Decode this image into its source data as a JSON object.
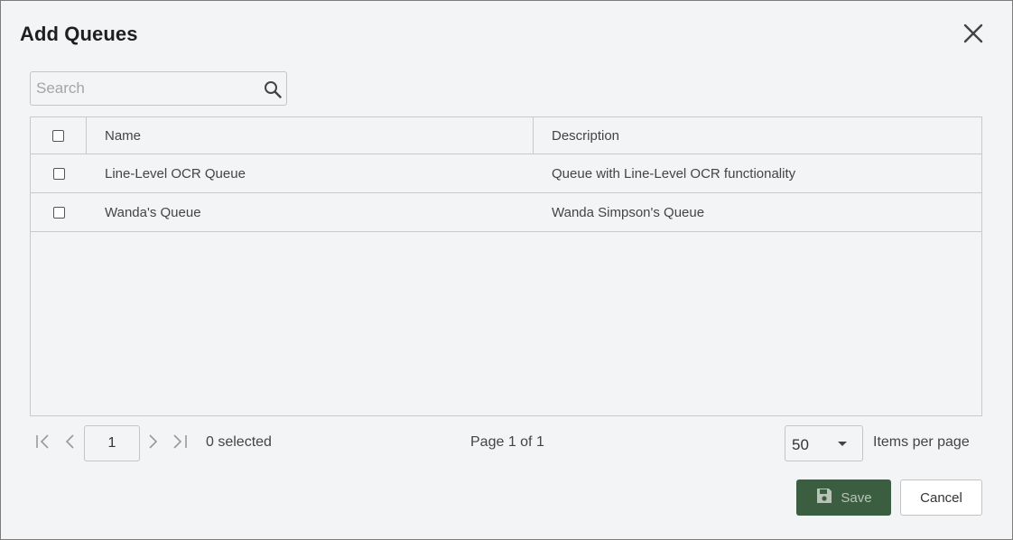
{
  "dialog": {
    "title": "Add Queues",
    "close_icon": "close-icon"
  },
  "search": {
    "placeholder": "Search",
    "value": "",
    "icon": "search-icon"
  },
  "table": {
    "columns": [
      "Name",
      "Description"
    ],
    "rows": [
      {
        "name": "Line-Level OCR Queue",
        "description": "Queue with Line-Level OCR functionality",
        "checked": false
      },
      {
        "name": "Wanda's Queue",
        "description": "Wanda Simpson's Queue",
        "checked": false
      }
    ]
  },
  "pagination": {
    "first_icon": "first-page-icon",
    "prev_icon": "previous-page-icon",
    "next_icon": "next-page-icon",
    "last_icon": "last-page-icon",
    "current_page": "1",
    "selected_text": "0 selected",
    "page_info": "Page 1 of 1",
    "items_per_page_value": "50",
    "items_per_page_label": "Items per page"
  },
  "actions": {
    "save_label": "Save",
    "save_icon": "floppy-disk-icon",
    "cancel_label": "Cancel"
  },
  "colors": {
    "background": "#f3f4f6",
    "primary_button": "#3b5e40",
    "border": "#c9c9c9"
  }
}
